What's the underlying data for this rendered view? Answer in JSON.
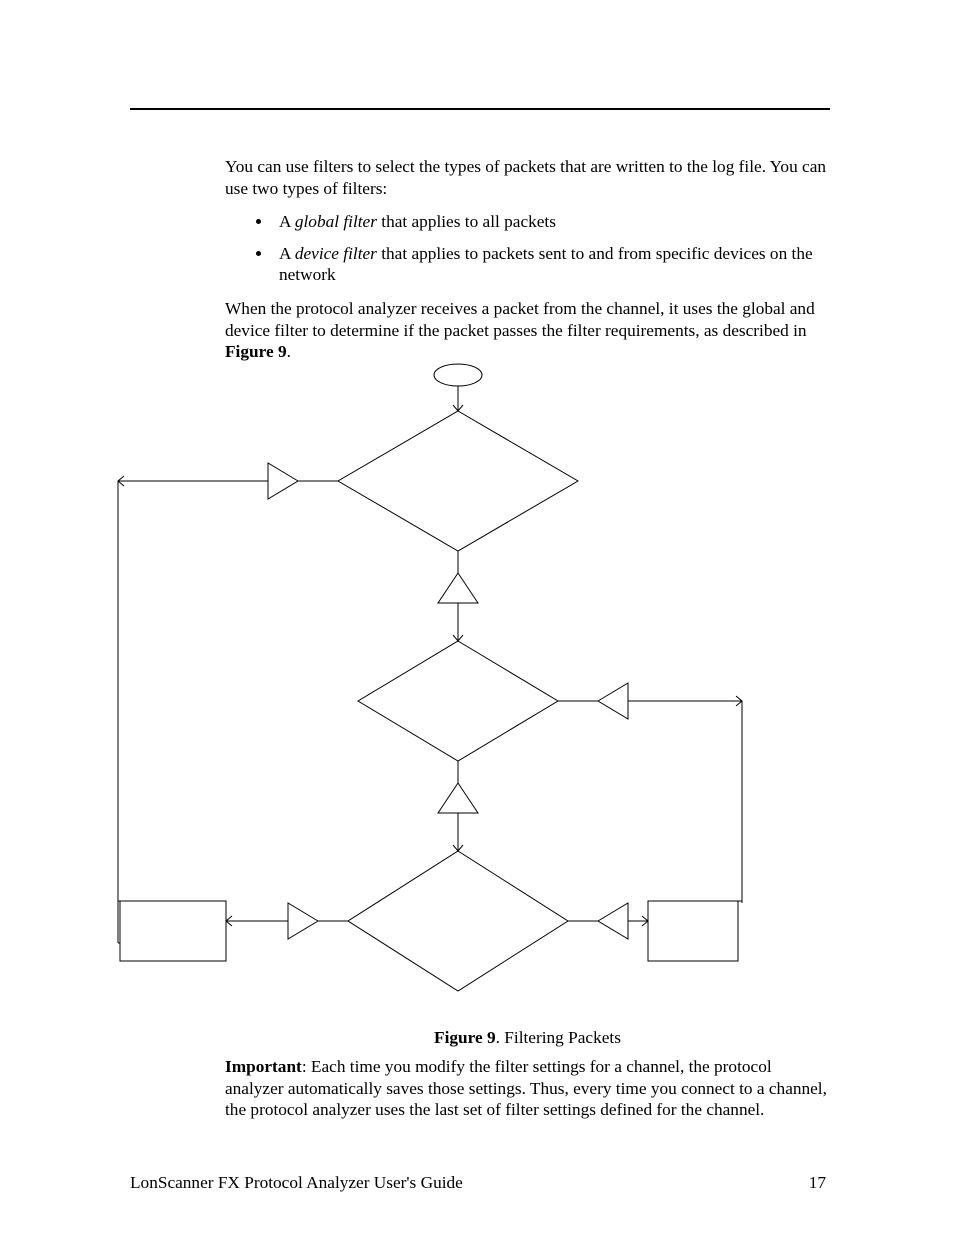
{
  "paragraph1": "You can use filters to select the types of packets that are written to the log file. You can use two types of filters:",
  "bullet1_prefix": "A ",
  "bullet1_italic": "global filter",
  "bullet1_suffix": " that applies to all packets",
  "bullet2_prefix": "A ",
  "bullet2_italic": "device filter",
  "bullet2_suffix": " that applies to packets sent to and from specific devices on the network",
  "paragraph2_prefix": "When the protocol analyzer receives a packet from the channel, it uses the global and device filter to determine if the packet passes the filter requirements, as described in ",
  "paragraph2_bold": "Figure 9",
  "paragraph2_suffix": ".",
  "figure_label_bold": "Figure 9",
  "figure_label_rest": ". Filtering Packets",
  "important_label": "Important",
  "important_text": ":  Each time you modify the filter settings for a channel, the protocol analyzer automatically saves those settings.  Thus, every time you connect to a channel, the protocol analyzer uses the last set of filter settings defined for the channel.",
  "footer_left": "LonScanner FX Protocol Analyzer User's Guide",
  "footer_right": "17"
}
